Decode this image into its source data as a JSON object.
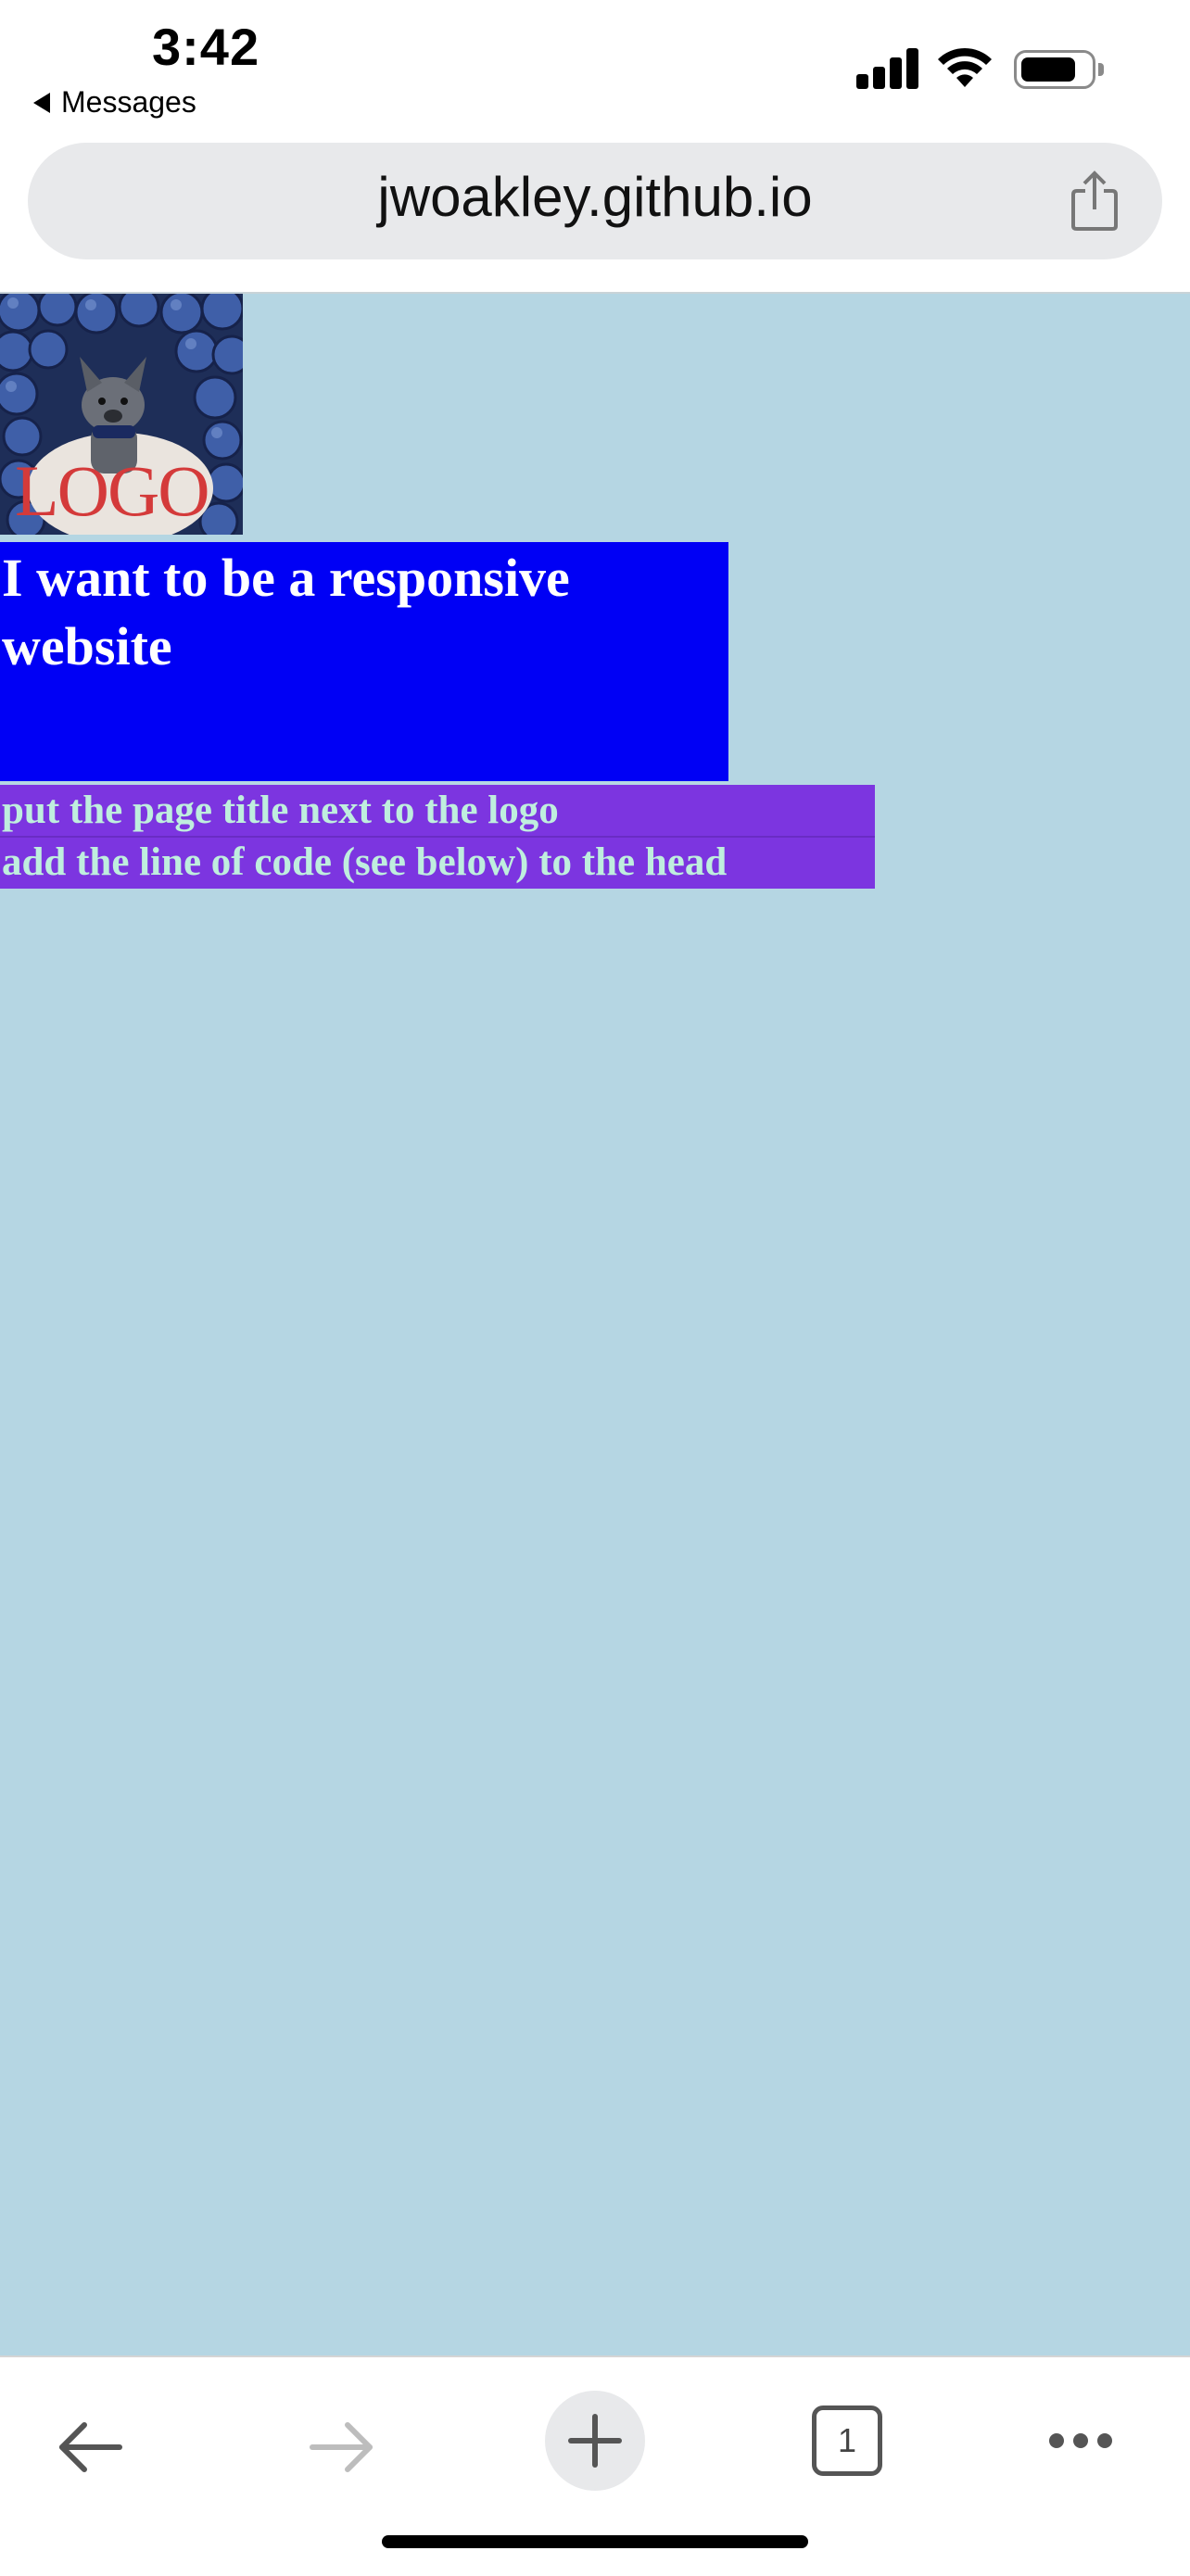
{
  "status_bar": {
    "time": "3:42",
    "back_label": "Messages",
    "icons": [
      "signal-icon",
      "wifi-icon",
      "battery-icon"
    ]
  },
  "browser": {
    "url": "jwoakley.github.io",
    "share_icon": "share-icon"
  },
  "page": {
    "background": "#b5d6e3",
    "logo": {
      "text": "LOGO"
    },
    "title": "I want to be a responsive website",
    "tasks": [
      "put the page title next to the logo",
      "add the line of code (see below) to the head"
    ]
  },
  "toolbar": {
    "tab_count": "1",
    "buttons": [
      "back-arrow-icon",
      "forward-arrow-icon",
      "plus-icon",
      "tabs-icon",
      "more-icon"
    ]
  }
}
